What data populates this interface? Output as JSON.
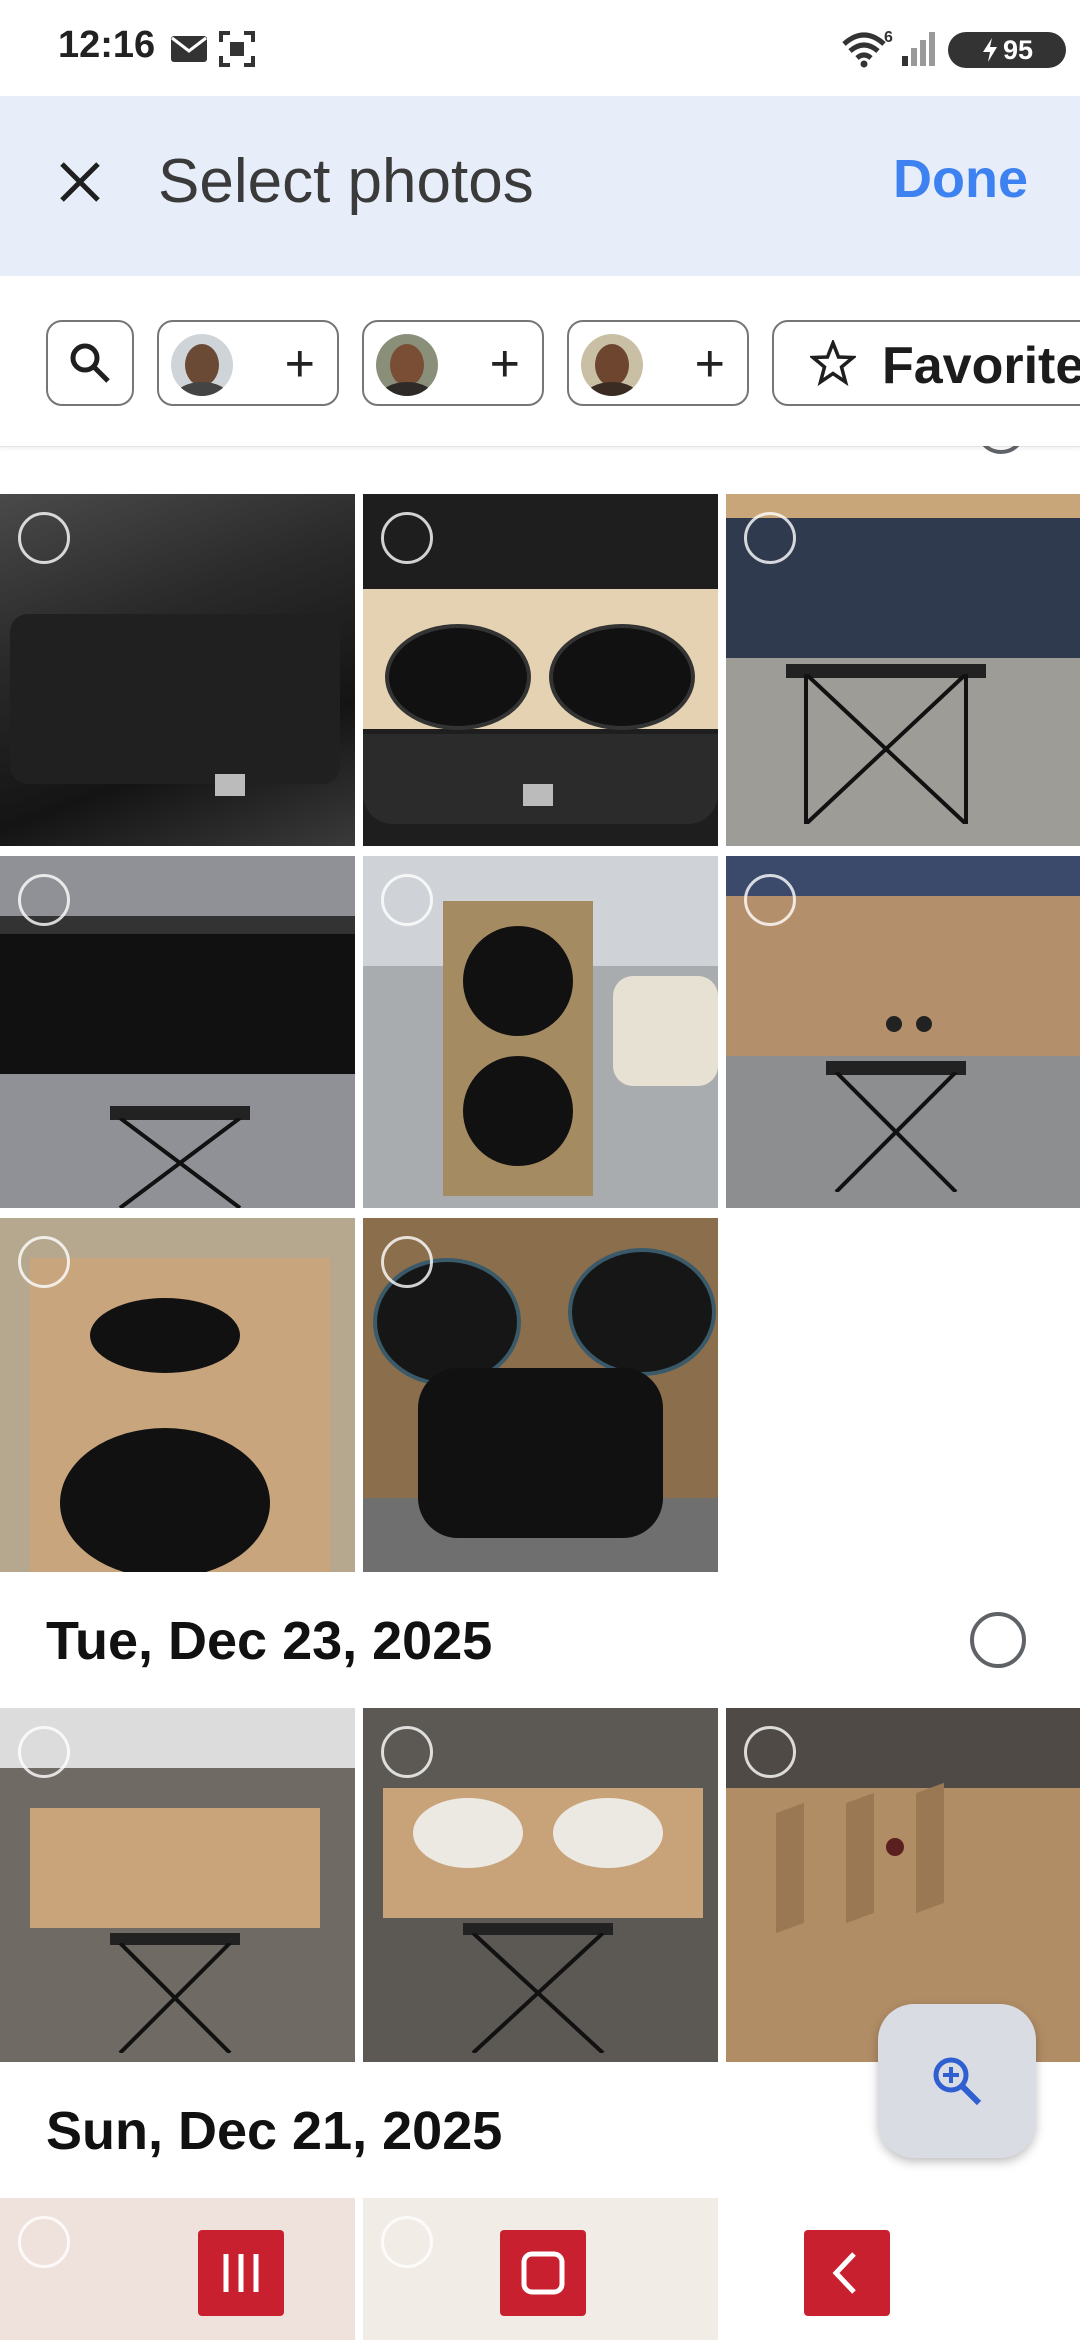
{
  "status_bar": {
    "time": "12:16",
    "battery": "95",
    "icons": [
      "mail-icon",
      "screenshot-icon",
      "wifi-icon",
      "signal-icon",
      "battery-charging-icon"
    ]
  },
  "header": {
    "title": "Select photos",
    "done_label": "Done",
    "close_icon": "close-icon"
  },
  "filters": {
    "search_icon": "search-icon",
    "people": [
      {
        "name": "person-1"
      },
      {
        "name": "person-2"
      },
      {
        "name": "person-3"
      }
    ],
    "favorites_label": "Favorites"
  },
  "sections": [
    {
      "date": "Tue, Dec 23, 2025"
    },
    {
      "date": "Sun, Dec 21, 2025"
    }
  ],
  "fab": {
    "icon": "zoom-in-icon"
  },
  "nav": {
    "icons": [
      "recent-apps-icon",
      "home-icon",
      "back-icon"
    ]
  },
  "colors": {
    "accent": "#3d82f0",
    "header_bg": "#e8eef9",
    "nav_button": "#c8202e"
  }
}
